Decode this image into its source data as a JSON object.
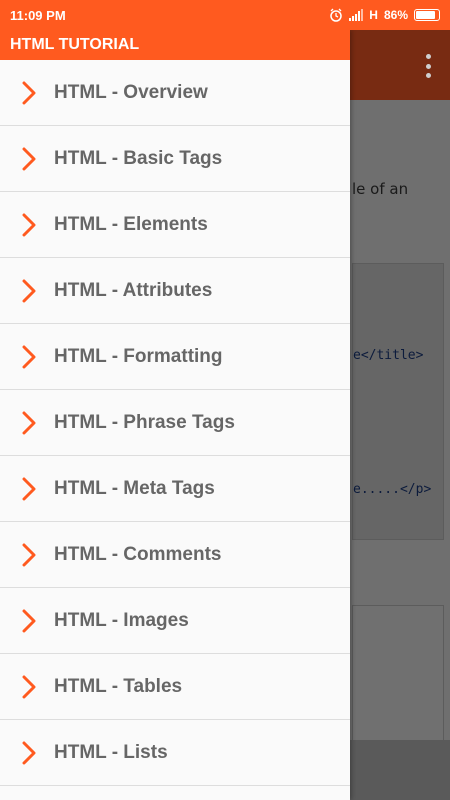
{
  "status_bar": {
    "time": "11:09 PM",
    "network": "H",
    "battery": "86%",
    "battery_level": 0.86,
    "icons": [
      "alarm-icon",
      "signal-icon",
      "battery-icon"
    ]
  },
  "drawer": {
    "title": "HTML TUTORIAL",
    "items": [
      {
        "label": "HTML - Overview"
      },
      {
        "label": "HTML - Basic Tags"
      },
      {
        "label": "HTML - Elements"
      },
      {
        "label": "HTML - Attributes"
      },
      {
        "label": "HTML - Formatting"
      },
      {
        "label": "HTML - Phrase Tags"
      },
      {
        "label": "HTML - Meta Tags"
      },
      {
        "label": "HTML - Comments"
      },
      {
        "label": "HTML - Images"
      },
      {
        "label": "HTML - Tables"
      },
      {
        "label": "HTML - Lists"
      }
    ]
  },
  "background": {
    "menu_icon": "overflow-menu-icon",
    "text_fragment": "le of an",
    "code_line_1": "e</title>",
    "code_line_2": "e.....</p>"
  },
  "colors": {
    "accent": "#ff5a1f",
    "chevron": "#ff5a1f",
    "dimmed_toolbar": "#782b12",
    "scrim": "#6f6f6f",
    "item_text": "#666666"
  }
}
